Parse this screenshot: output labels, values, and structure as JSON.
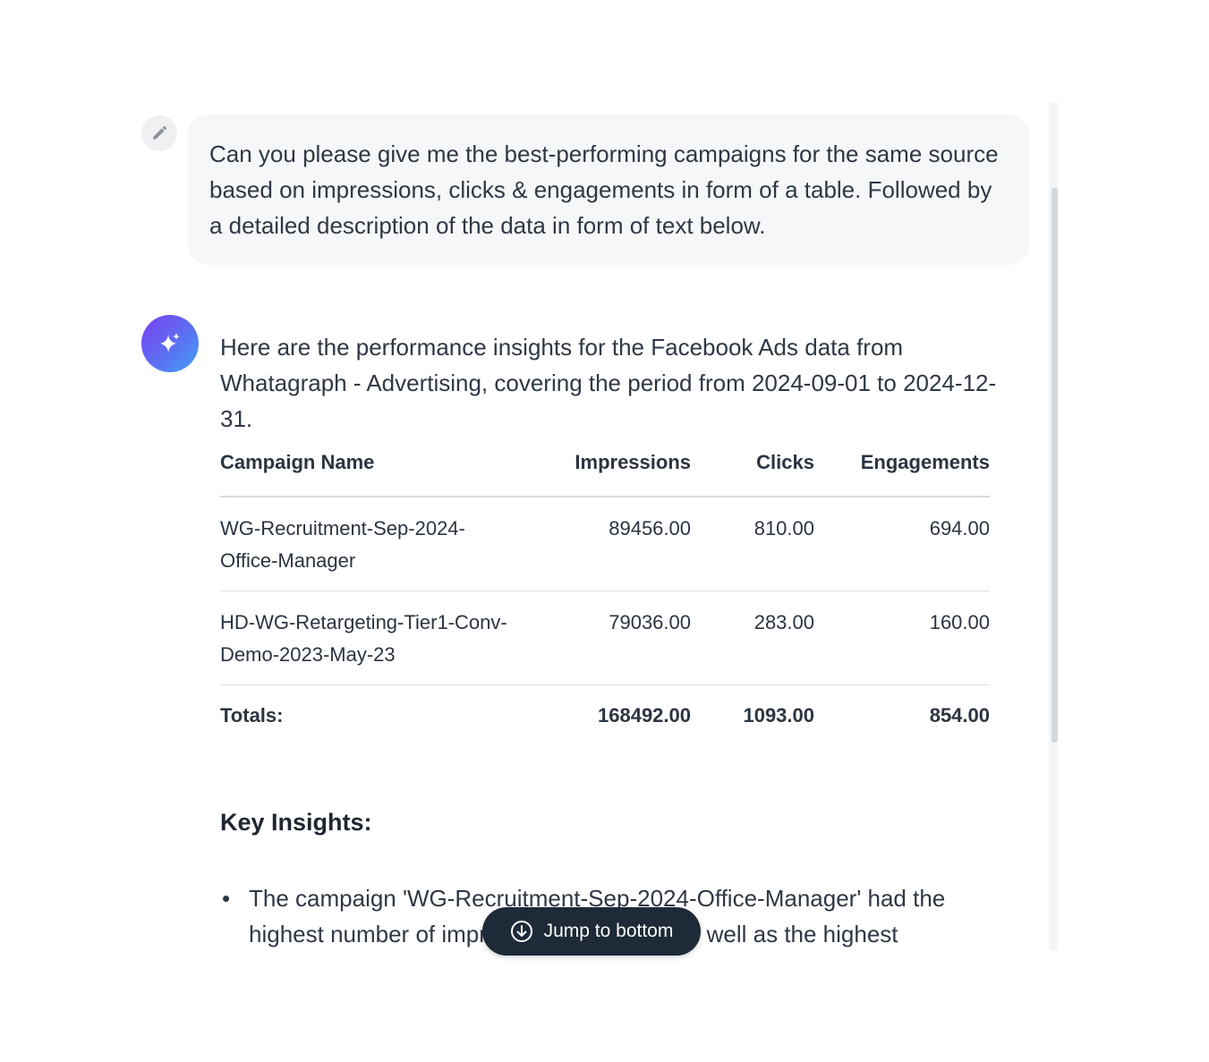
{
  "user_message": {
    "text": "Can you please give me the best-performing campaigns for the same source based on impressions, clicks & engagements in form of a table. Followed by a detailed description of the data in form of text below."
  },
  "assistant_message": {
    "intro": "Here are the performance insights for the Facebook Ads data from Whatagraph - Advertising, covering the period from 2024-09-01 to 2024-12-31.",
    "table": {
      "headers": {
        "name": "Campaign Name",
        "impressions": "Impressions",
        "clicks": "Clicks",
        "engagements": "Engagements"
      },
      "rows": [
        {
          "name": "WG-Recruitment-Sep-2024-Office-Manager",
          "impressions": "89456.00",
          "clicks": "810.00",
          "engagements": "694.00"
        },
        {
          "name": "HD-WG-Retargeting-Tier1-Conv-Demo-2023-May-23",
          "impressions": "79036.00",
          "clicks": "283.00",
          "engagements": "160.00"
        }
      ],
      "totals": {
        "label": "Totals:",
        "impressions": "168492.00",
        "clicks": "1093.00",
        "engagements": "854.00"
      }
    },
    "insights_heading": "Key Insights:",
    "insights": [
      "The campaign 'WG-Recruitment-Sep-2024-Office-Manager' had the highest number of impressions at 89456, as well as the highest"
    ]
  },
  "jump_button": {
    "label": "Jump to bottom"
  },
  "icons": {
    "edit": "pencil-icon",
    "assistant": "sparkle-icon",
    "jump": "arrow-down-circle-icon"
  },
  "colors": {
    "avatar_gradient_start": "#7b3ff0",
    "avatar_gradient_end": "#3fa3f4",
    "jump_button_bg": "#1e2a38"
  }
}
